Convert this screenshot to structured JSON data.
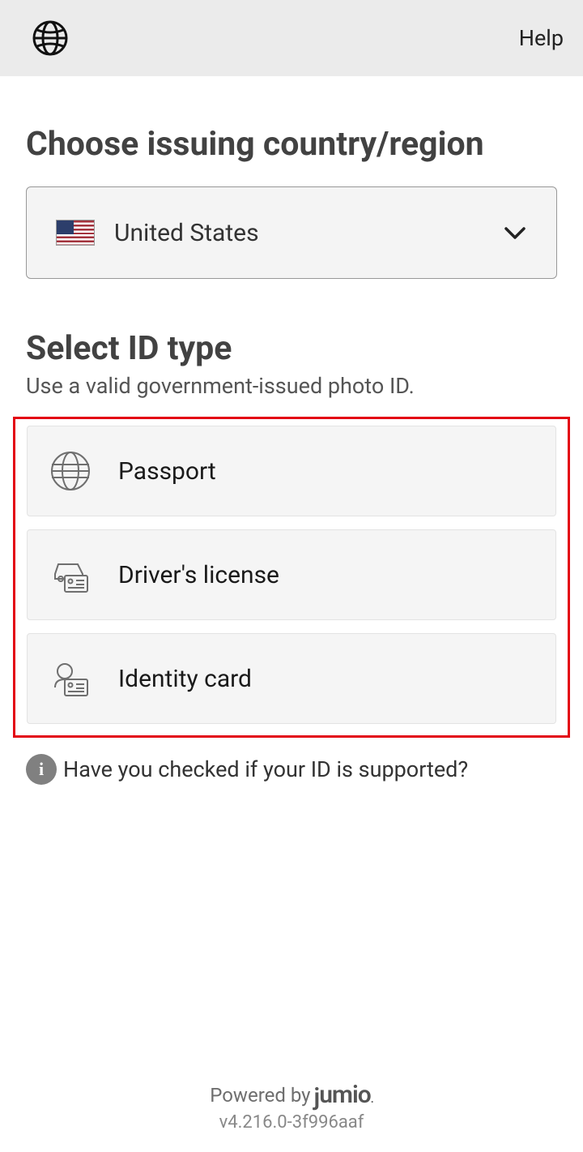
{
  "header": {
    "help_label": "Help"
  },
  "country": {
    "heading": "Choose issuing country/region",
    "selected": "United States"
  },
  "id_type": {
    "heading": "Select ID type",
    "subtext": "Use a valid government-issued photo ID.",
    "options": [
      {
        "label": "Passport"
      },
      {
        "label": "Driver's license"
      },
      {
        "label": "Identity card"
      }
    ]
  },
  "info": {
    "text": "Have you checked if your ID is supported?"
  },
  "footer": {
    "powered_by": "Powered by",
    "brand": "jumio",
    "version": "v4.216.0-3f996aaf"
  }
}
